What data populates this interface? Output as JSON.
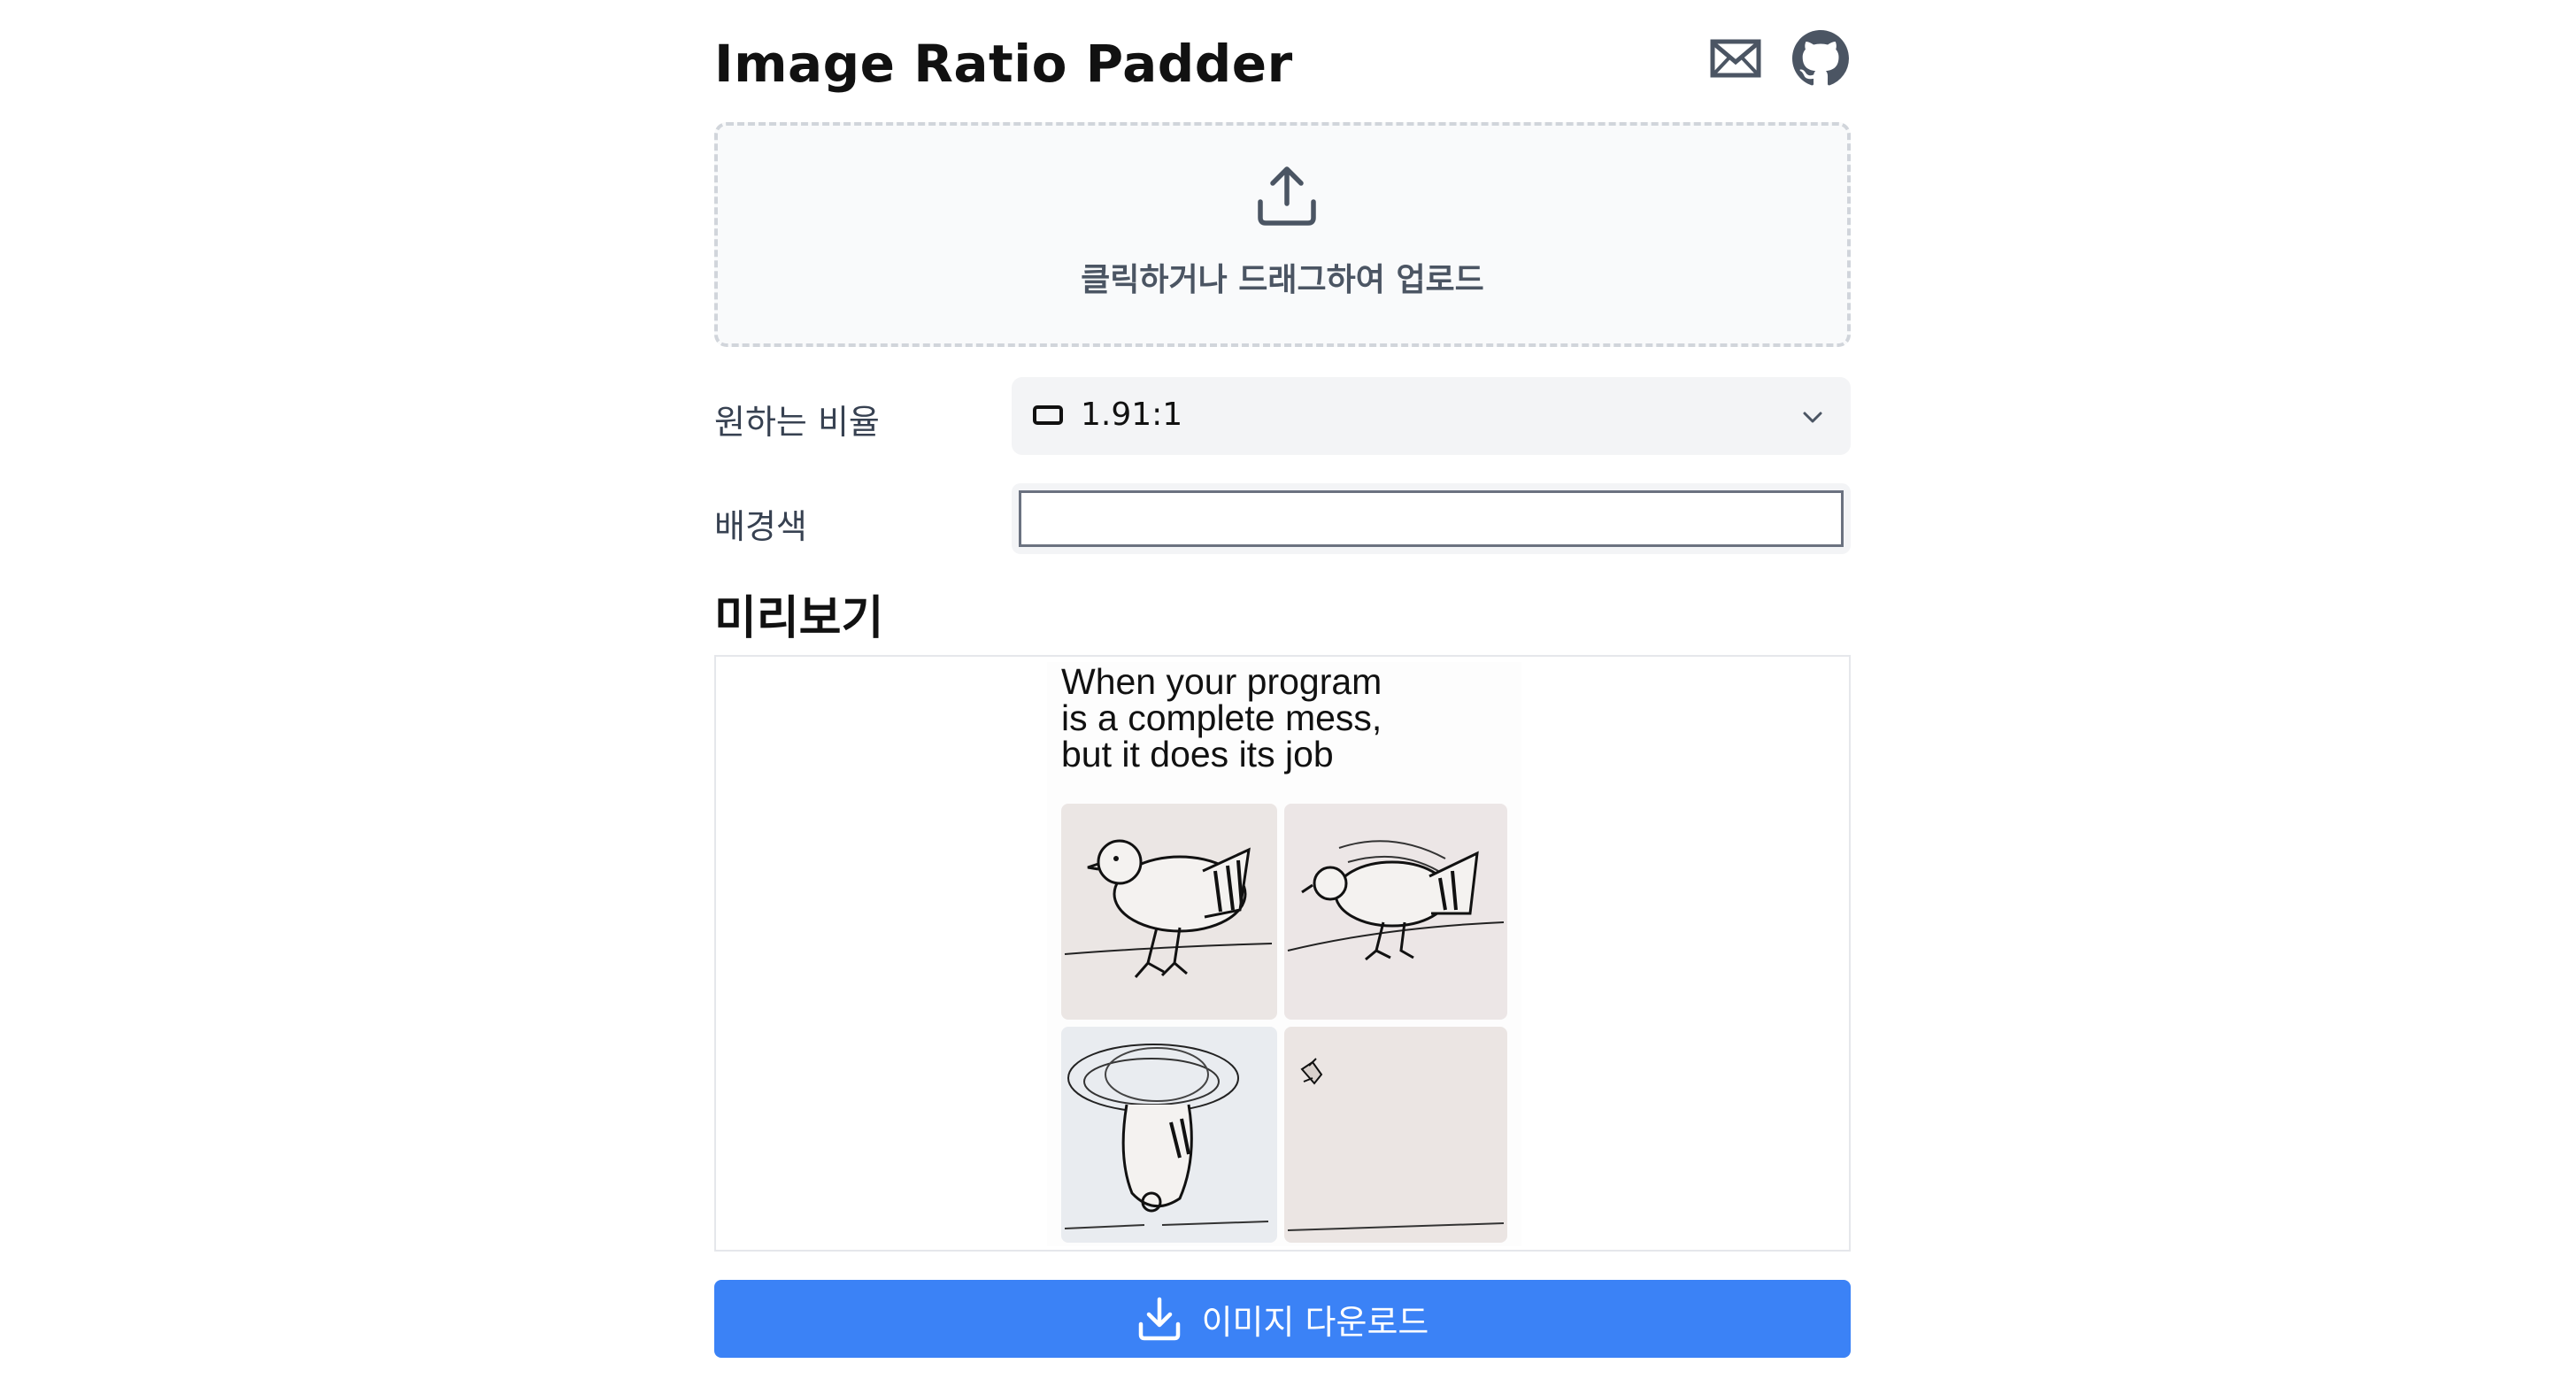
{
  "header": {
    "title": "Image Ratio Padder",
    "icons": [
      "mail-icon",
      "github-icon"
    ]
  },
  "upload": {
    "icon": "upload-icon",
    "text": "클릭하거나 드래그하여 업로드"
  },
  "ratio": {
    "label": "원하는 비율",
    "selected": "1.91:1",
    "icon": "landscape-rect-icon"
  },
  "background": {
    "label": "배경색",
    "color": "#ffffff"
  },
  "preview": {
    "title": "미리보기",
    "caption_lines": [
      "When your program",
      "is a complete mess,",
      "but it does its job"
    ]
  },
  "download": {
    "label": "이미지 다운로드",
    "icon": "download-icon"
  },
  "colors": {
    "accent": "#3b82f6",
    "dropzone_bg": "#f9fafb",
    "field_bg": "#f3f4f6"
  }
}
